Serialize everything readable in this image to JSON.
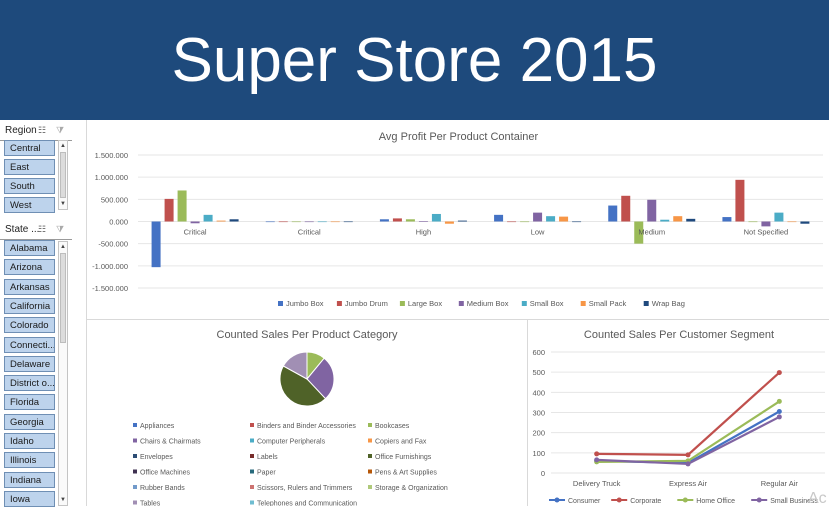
{
  "banner": {
    "title": "Super Store 2015"
  },
  "slicers": {
    "region": {
      "title": "Region",
      "items": [
        "Central",
        "East",
        "South",
        "West"
      ]
    },
    "state": {
      "title": "State ...",
      "items": [
        "Alabama",
        "Arizona",
        "Arkansas",
        "California",
        "Colorado",
        "Connecti...",
        "Delaware",
        "District o...",
        "Florida",
        "Georgia",
        "Idaho",
        "Illinois",
        "Indiana",
        "Iowa"
      ]
    }
  },
  "icons": {
    "multi_select": "multi-select-icon",
    "clear_filter": "clear-filter-icon",
    "scroll_up": "scroll-up-icon",
    "scroll_down": "scroll-down-icon"
  },
  "colors": {
    "banner": "#1e4a7c",
    "slicer_item": "#bdd3ec"
  },
  "watermark": "Ac",
  "chart_data": [
    {
      "type": "bar",
      "title": "Avg Profit Per Product Container",
      "categories": [
        "Critical",
        "Critical",
        "High",
        "Low",
        "Medium",
        "Not Specified"
      ],
      "ylim": [
        -1500,
        1500
      ],
      "yticks": [
        "1.500.000",
        "1.000.000",
        "500.000",
        "0.000",
        "-500.000",
        "-1.000.000",
        "-1.500.000"
      ],
      "series": [
        {
          "name": "Jumbo Box",
          "color": "#4472c4",
          "values": [
            -1030,
            0,
            50,
            150,
            360,
            100
          ]
        },
        {
          "name": "Jumbo Drum",
          "color": "#c0504d",
          "values": [
            510,
            0,
            70,
            0,
            580,
            940
          ]
        },
        {
          "name": "Large Box",
          "color": "#9bbb59",
          "values": [
            700,
            0,
            50,
            0,
            -500,
            -10
          ]
        },
        {
          "name": "Medium Box",
          "color": "#8064a2",
          "values": [
            -40,
            0,
            10,
            200,
            490,
            -110
          ]
        },
        {
          "name": "Small Box",
          "color": "#4bacc6",
          "values": [
            150,
            0,
            170,
            120,
            40,
            200
          ]
        },
        {
          "name": "Small Pack",
          "color": "#f79646",
          "values": [
            20,
            -10,
            -50,
            110,
            120,
            -10
          ]
        },
        {
          "name": "Wrap Bag",
          "color": "#1f497d",
          "values": [
            50,
            0,
            20,
            0,
            60,
            -50
          ]
        }
      ],
      "legend": "bottom",
      "grid": true
    },
    {
      "type": "pie",
      "title": "Counted Sales Per Product Category",
      "legend": "bottom",
      "slices": [
        {
          "name": "Appliances",
          "color": "#4472c4",
          "value": 0
        },
        {
          "name": "Binders and Binder Accessories",
          "color": "#c0504d",
          "value": 0
        },
        {
          "name": "Bookcases",
          "color": "#9bbb59",
          "value": 11
        },
        {
          "name": "Chairs & Chairmats",
          "color": "#8064a2",
          "value": 27
        },
        {
          "name": "Computer Peripherals",
          "color": "#4bacc6",
          "value": 0
        },
        {
          "name": "Copiers and Fax",
          "color": "#f79646",
          "value": 0
        },
        {
          "name": "Envelopes",
          "color": "#2c4d75",
          "value": 0
        },
        {
          "name": "Labels",
          "color": "#772c2a",
          "value": 0
        },
        {
          "name": "Office Furnishings",
          "color": "#4f6228",
          "value": 45
        },
        {
          "name": "Office Machines",
          "color": "#3f3151",
          "value": 0
        },
        {
          "name": "Paper",
          "color": "#276a7c",
          "value": 0
        },
        {
          "name": "Pens & Art Supplies",
          "color": "#b65708",
          "value": 0
        },
        {
          "name": "Rubber Bands",
          "color": "#729aca",
          "value": 0
        },
        {
          "name": "Scissors, Rulers and Trimmers",
          "color": "#cd7371",
          "value": 0
        },
        {
          "name": "Storage & Organization",
          "color": "#afc97a",
          "value": 0
        },
        {
          "name": "Tables",
          "color": "#a18fb4",
          "value": 17
        },
        {
          "name": "Telephones and Communication",
          "color": "#6fbdd1",
          "value": 0
        }
      ]
    },
    {
      "type": "line",
      "title": "Counted Sales Per Customer Segment",
      "categories": [
        "Delivery Truck",
        "Express Air",
        "Regular Air"
      ],
      "ylim": [
        0,
        600
      ],
      "yticks": [
        0,
        100,
        200,
        300,
        400,
        500,
        600
      ],
      "series": [
        {
          "name": "Consumer",
          "color": "#4472c4",
          "values": [
            60,
            50,
            305
          ]
        },
        {
          "name": "Corporate",
          "color": "#c0504d",
          "values": [
            95,
            90,
            498
          ]
        },
        {
          "name": "Home Office",
          "color": "#9bbb59",
          "values": [
            55,
            60,
            355
          ]
        },
        {
          "name": "Small Business",
          "color": "#8064a2",
          "values": [
            65,
            45,
            278
          ]
        }
      ],
      "legend": "bottom",
      "grid": true
    }
  ]
}
